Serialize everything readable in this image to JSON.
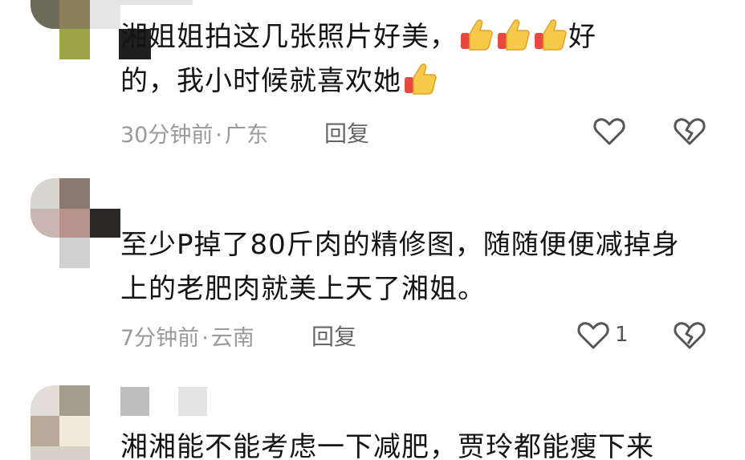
{
  "comments": [
    {
      "text_line1": "湘姐姐拍这几张照片好美，",
      "text_line1_end": "好",
      "text_line2": "的，我小时候就喜欢她",
      "time": "30分钟前",
      "location": "广东",
      "separator": "·",
      "reply_label": "回复",
      "like_count": ""
    },
    {
      "text_line1": "至少P掉了80斤肉的精修图，随随便便减掉身",
      "text_line2": "上的老肥肉就美上天了湘姐。",
      "time": "7分钟前",
      "location": "云南",
      "separator": "·",
      "reply_label": "回复",
      "like_count": "1"
    },
    {
      "text_line1": "湘湘能不能考虑一下减肥，贾玲都能瘦下来"
    }
  ],
  "icons": {
    "like": "heart-outline-icon",
    "dislike": "broken-heart-icon",
    "emoji": "thumbs-up-emoji"
  },
  "colors": {
    "text": "#141414",
    "meta": "#9a9a9a",
    "icon": "#555555"
  }
}
